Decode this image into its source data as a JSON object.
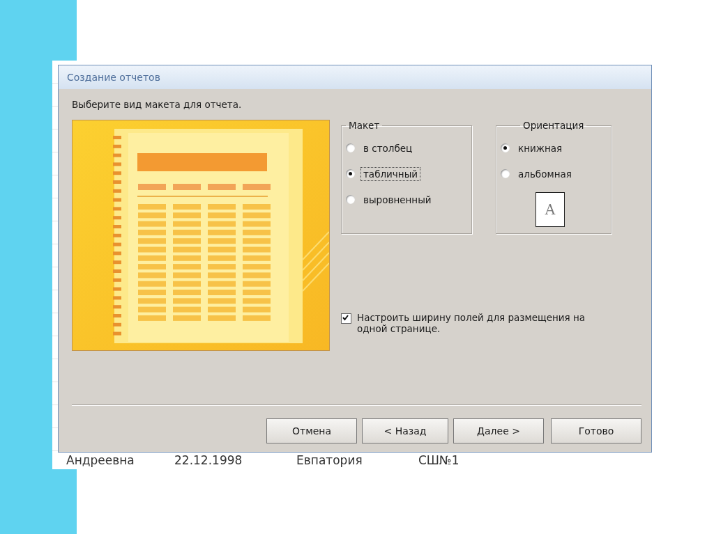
{
  "window": {
    "title": "Создание отчетов"
  },
  "instruction": "Выберите вид макета для отчета.",
  "layout_group": {
    "title": "Макет",
    "options": [
      {
        "label": "в столбец",
        "selected": false,
        "focused": false
      },
      {
        "label": "табличный",
        "selected": true,
        "focused": true
      },
      {
        "label": "выровненный",
        "selected": false,
        "focused": false
      }
    ]
  },
  "orientation_group": {
    "title": "Ориентация",
    "options": [
      {
        "label": "книжная",
        "selected": true
      },
      {
        "label": "альбомная",
        "selected": false
      }
    ],
    "preview_letter": "A"
  },
  "fit_checkbox": {
    "label": "Настроить ширину полей для размещения на одной странице.",
    "checked": true
  },
  "buttons": [
    "Отмена",
    "< Назад",
    "Далее >",
    "Готово"
  ],
  "sheet_row": [
    "Андреевна",
    "22.12.1998",
    "Евпатория",
    "СШ№1"
  ]
}
